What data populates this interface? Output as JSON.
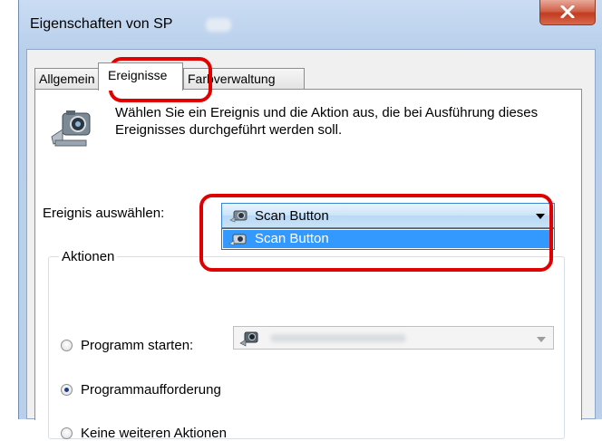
{
  "window": {
    "title": "Eigenschaften von SP",
    "close_label": "X"
  },
  "tabs": [
    {
      "label": "Allgemein"
    },
    {
      "label": "Ereignisse"
    },
    {
      "label": "Farbverwaltung"
    }
  ],
  "events_tab": {
    "description": "Wählen Sie ein Ereignis und die Aktion aus, die bei Ausführung dieses Ereignisses durchgeführt werden soll.",
    "event_label": "Ereignis auswählen:",
    "event_selected": "Scan Button",
    "event_options": [
      "Scan Button"
    ],
    "actions_legend": "Aktionen",
    "radio_program": "Programm starten:",
    "radio_prompt": "Programmaufforderung",
    "radio_none": "Keine weiteren Aktionen",
    "selected_action": "Programmaufforderung"
  },
  "colors": {
    "highlight": "#e00000",
    "selection": "#3399ff"
  }
}
